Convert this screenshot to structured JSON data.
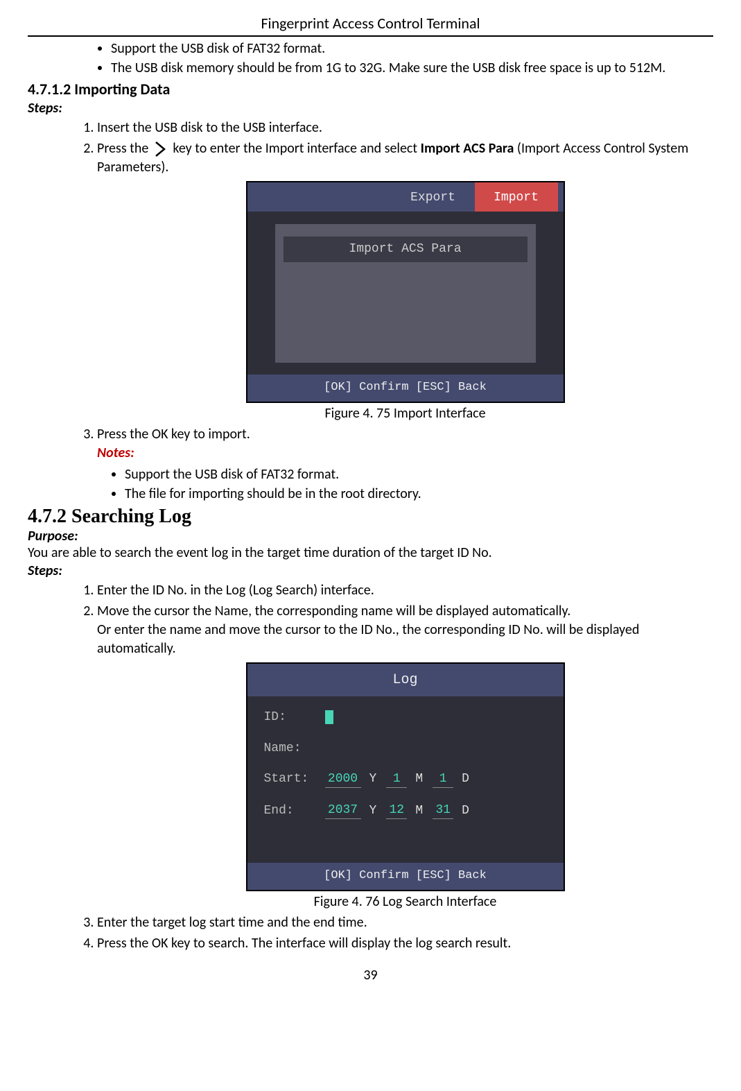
{
  "doc_title": "Fingerprint Access Control Terminal",
  "intro_bullets": [
    "Support the USB disk of FAT32 format.",
    "The USB disk memory should be from 1G to 32G. Make sure the USB disk free space is up to 512M."
  ],
  "sec_4_7_1_2": {
    "heading": "4.7.1.2 Importing Data",
    "steps_label": "Steps:",
    "steps": {
      "s1": "Insert the USB disk to the USB interface.",
      "s2_a": "Press the",
      "s2_b": "key to enter the Import interface and select ",
      "s2_bold": "Import ACS Para",
      "s2_c": " (Import Access Control System Parameters).",
      "s3": "Press the OK key to import."
    },
    "ui": {
      "tab_export": "Export",
      "tab_import": "Import",
      "item": "Import ACS Para",
      "footer": "[OK] Confirm   [ESC] Back"
    },
    "fig_caption": "Figure 4. 75 Import Interface",
    "notes_label": "Notes:",
    "notes": [
      "Support the USB disk of FAT32 format.",
      "The file for importing should be in the root directory."
    ]
  },
  "sec_4_7_2": {
    "heading": "4.7.2   Searching Log",
    "purpose_label": "Purpose:",
    "purpose": "You are able to search the event log in the target time duration of the target ID No.",
    "steps_label": "Steps:",
    "steps": {
      "s1": "Enter the ID No. in the Log (Log Search) interface.",
      "s2a": "Move the cursor the Name, the corresponding name will be displayed automatically.",
      "s2b": "Or enter the name and move the cursor to the ID No., the corresponding ID No. will be displayed automatically.",
      "s3": "Enter the target log start time and the end time.",
      "s4": "Press the OK key to search. The interface will display the log search result."
    },
    "ui": {
      "title": "Log",
      "id_label": "ID:",
      "name_label": "Name:",
      "start_label": "Start:",
      "end_label": "End:",
      "start": {
        "y": "2000",
        "m": "1",
        "d": "1"
      },
      "end": {
        "y": "2037",
        "m": "12",
        "d": "31"
      },
      "unit_y": "Y",
      "unit_m": "M",
      "unit_d": "D",
      "footer": "[OK] Confirm   [ESC] Back"
    },
    "fig_caption": "Figure 4. 76 Log Search Interface"
  },
  "page_number": "39"
}
